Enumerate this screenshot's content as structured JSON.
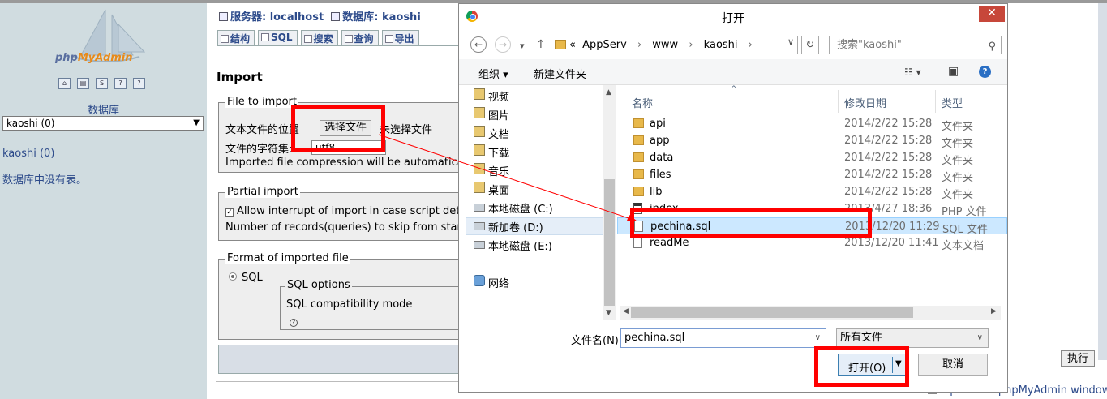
{
  "phpmyadmin": {
    "logo_part1": "php",
    "logo_part2": "MyAdmin",
    "nav_icons": [
      "home-icon",
      "query-window-icon",
      "sql-icon",
      "docs-icon",
      "help-icon"
    ],
    "db_label": "数据库",
    "db_select": "kaoshi (0)",
    "db_link": "kaoshi (0)",
    "no_tables": "数据库中没有表。"
  },
  "main": {
    "server_label": "服务器: localhost",
    "db_breadcrumb": "数据库: kaoshi",
    "tabs": [
      "结构",
      "SQL",
      "搜索",
      "查询",
      "导出"
    ],
    "heading": "Import",
    "file_fieldset": {
      "legend": "File to import",
      "location_label": "文本文件的位置",
      "choose_button": "选择文件",
      "no_file": "未选择文件",
      "charset_label": "文件的字符集:",
      "charset_value": "utf8",
      "compression_text": "Imported file compression will be automatically"
    },
    "partial_fieldset": {
      "legend": "Partial import",
      "allow_interrupt": "Allow interrupt of import in case script dete",
      "skip_records": "Number of records(queries) to skip from start"
    },
    "format_fieldset": {
      "legend": "Format of imported file",
      "sql_radio": "SQL",
      "options_legend": "SQL options",
      "compat_mode": "SQL compatibility mode"
    },
    "exec_button": "执行",
    "open_new_window": "Open new phpMyAdmin window"
  },
  "dialog": {
    "title": "打开",
    "close": "✕",
    "address": {
      "prefix": "«",
      "parts": [
        "AppServ",
        "www",
        "kaoshi"
      ],
      "separator": "›"
    },
    "search_placeholder": "搜索\"kaoshi\"",
    "organize": "组织 ▾",
    "new_folder": "新建文件夹",
    "nav_items": [
      {
        "label": "视频",
        "icon": "folder"
      },
      {
        "label": "图片",
        "icon": "folder"
      },
      {
        "label": "文档",
        "icon": "folder"
      },
      {
        "label": "下载",
        "icon": "folder"
      },
      {
        "label": "音乐",
        "icon": "folder"
      },
      {
        "label": "桌面",
        "icon": "folder"
      },
      {
        "label": "本地磁盘 (C:)",
        "icon": "drive"
      },
      {
        "label": "新加卷 (D:)",
        "icon": "drive"
      },
      {
        "label": "本地磁盘 (E:)",
        "icon": "drive"
      },
      {
        "label": "网络",
        "icon": "network"
      }
    ],
    "columns": {
      "name": "名称",
      "date": "修改日期",
      "type": "类型"
    },
    "files": [
      {
        "name": "api",
        "date": "2014/2/22 15:28",
        "type": "文件夹",
        "icon": "folder"
      },
      {
        "name": "app",
        "date": "2014/2/22 15:28",
        "type": "文件夹",
        "icon": "folder"
      },
      {
        "name": "data",
        "date": "2014/2/22 15:28",
        "type": "文件夹",
        "icon": "folder"
      },
      {
        "name": "files",
        "date": "2014/2/22 15:28",
        "type": "文件夹",
        "icon": "folder"
      },
      {
        "name": "lib",
        "date": "2014/2/22 15:28",
        "type": "文件夹",
        "icon": "folder"
      },
      {
        "name": "index",
        "date": "2013/4/27 18:36",
        "type": "PHP 文件",
        "icon": "php"
      },
      {
        "name": "pechina.sql",
        "date": "2013/12/20 11:29",
        "type": "SQL 文件",
        "icon": "doc",
        "selected": true
      },
      {
        "name": "readMe",
        "date": "2013/12/20 11:41",
        "type": "文本文档",
        "icon": "doc"
      }
    ],
    "filename_label": "文件名(N):",
    "filename_value": "pechina.sql",
    "filetype_value": "所有文件",
    "open_button": "打开(O)",
    "cancel_button": "取消"
  },
  "annotation_color": "#ff0000"
}
